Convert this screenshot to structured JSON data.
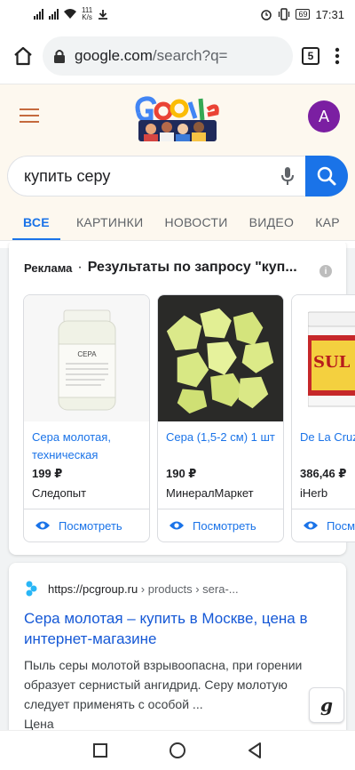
{
  "status_bar": {
    "speed_value": "111",
    "speed_unit": "K/s",
    "battery": "69",
    "time": "17:31"
  },
  "browser": {
    "url_domain": "google.com",
    "url_path": "/search?q=",
    "tab_count": "5"
  },
  "header": {
    "avatar_letter": "A"
  },
  "search": {
    "query": "купить серу"
  },
  "nav_tabs": [
    "ВСЕ",
    "КАРТИНКИ",
    "НОВОСТИ",
    "ВИДЕО",
    "КАР"
  ],
  "ads": {
    "label": "Реклама",
    "separator": "·",
    "title": "Результаты по запросу \"куп...",
    "products": [
      {
        "name": "Сера молотая, техническая",
        "price": "199 ₽",
        "shop": "Следопыт",
        "action": "Посмотреть"
      },
      {
        "name": "Сера (1,5-2 см) 1 шт",
        "price": "190 ₽",
        "shop": "МинералМаркет",
        "action": "Посмотреть"
      },
      {
        "name": "De La Cruz мазь, лече",
        "price": "386,46 ₽",
        "shop": "iHerb",
        "action": "Посм"
      }
    ]
  },
  "organic": {
    "url": "https://pcgroup.ru",
    "path": "› products › sera-...",
    "title": "Сера молотая – купить в Москве, цена в интернет-магазине",
    "snippet": "Пыль серы молотой взрывоопасна, при горении образует сернистый ангидрид. Серу молотую следует применять с особой  ...",
    "next_line": "Цена"
  },
  "product_label_text": {
    "jar_label": "СЕРА",
    "jar3_label": "SUL"
  },
  "colors": {
    "accent": "#1a73e8",
    "header_bg": "#fdf8ef",
    "avatar": "#7b1fa2",
    "content_bg": "#f1f3f4"
  }
}
